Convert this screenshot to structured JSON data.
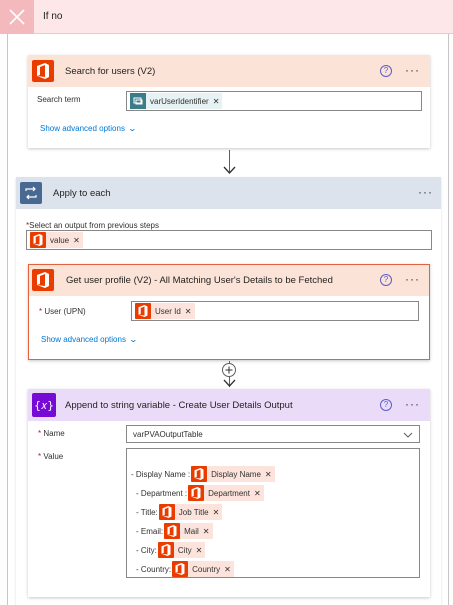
{
  "branch_header": {
    "title": "If no"
  },
  "search_users": {
    "title": "Search for users (V2)",
    "search_term_label": "Search term",
    "search_term_token": "varUserIdentifier",
    "advanced_link": "Show advanced options"
  },
  "apply_to_each": {
    "title": "Apply to each",
    "select_label": "Select an output from previous steps",
    "value_token": "value"
  },
  "get_profile": {
    "title": "Get user profile (V2) - All Matching User's Details to be Fetched",
    "upn_label": "User (UPN)",
    "upn_token": "User Id",
    "advanced_link": "Show advanced options"
  },
  "append_string": {
    "title": "Append to string variable - Create User Details Output",
    "name_label": "Name",
    "name_value": "varPVAOutputTable",
    "value_label": "Value",
    "rows": [
      {
        "prefix": "- Display Name :",
        "token": "Display Name"
      },
      {
        "prefix": "- Department :",
        "token": "Department"
      },
      {
        "prefix": "- Title:",
        "token": "Job Title"
      },
      {
        "prefix": "- Email:",
        "token": "Mail"
      },
      {
        "prefix": "- City:",
        "token": "City"
      },
      {
        "prefix": "- Country:",
        "token": "Country"
      }
    ]
  },
  "colors": {
    "office_orange": "#eb3c00",
    "token_bg": "#fce4dc",
    "header_pink": "#fde7e9",
    "search_card_head": "#fce3d8",
    "apply_head": "#dde3ec",
    "variable_purple": "#770bd6",
    "variable_head": "#eadcf8",
    "link_blue": "#0078d4",
    "selected_border": "#e3623e"
  },
  "icons": {
    "close": "close-icon",
    "office": "office-icon",
    "loop": "loop-icon",
    "variable": "variable-icon",
    "help": "help-icon",
    "more": "more-icon",
    "chevron": "chevron-down-icon",
    "add": "plus-icon"
  }
}
